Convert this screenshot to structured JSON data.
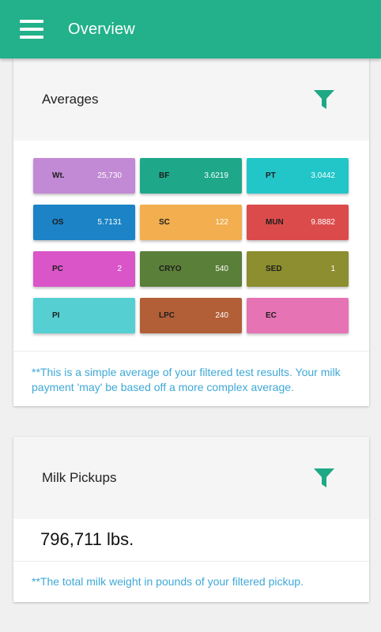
{
  "appbar": {
    "title": "Overview"
  },
  "averages": {
    "title": "Averages",
    "tiles": [
      {
        "label": "Wt.",
        "value": "25,730",
        "color": "#c28ad4"
      },
      {
        "label": "BF",
        "value": "3.6219",
        "color": "#1ea889"
      },
      {
        "label": "PT",
        "value": "3.0442",
        "color": "#22c6c9"
      },
      {
        "label": "OS",
        "value": "5.7131",
        "color": "#1b83c6"
      },
      {
        "label": "SC",
        "value": "122",
        "color": "#f2ae4f"
      },
      {
        "label": "MUN",
        "value": "9.8882",
        "color": "#dc4b4b"
      },
      {
        "label": "PC",
        "value": "2",
        "color": "#d955c8"
      },
      {
        "label": "CRYO",
        "value": "540",
        "color": "#5a7f39"
      },
      {
        "label": "SED",
        "value": "1",
        "color": "#8c8e2f"
      },
      {
        "label": "PI",
        "value": "",
        "color": "#55cfd2"
      },
      {
        "label": "LPC",
        "value": "240",
        "color": "#b25f38"
      },
      {
        "label": "EC",
        "value": "",
        "color": "#e673b4"
      }
    ],
    "note": "**This is a simple average of your filtered test results. Your milk payment 'may' be based off a more complex average."
  },
  "pickups": {
    "title": "Milk Pickups",
    "value": "796,711 lbs.",
    "note": "**The total milk weight in pounds of your filtered pickup."
  },
  "colors": {
    "brand": "#22b18a",
    "note": "#3fa8d6",
    "filter_icon": "#1fa884"
  },
  "icons": {
    "menu": "hamburger-icon",
    "filter": "filter-icon"
  }
}
